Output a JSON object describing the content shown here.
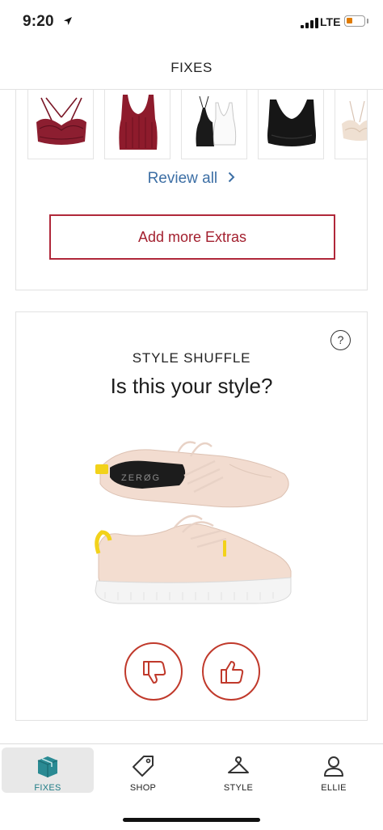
{
  "status_bar": {
    "time": "9:20",
    "network": "LTE",
    "icons": [
      "location-arrow-icon",
      "signal-icon",
      "battery-icon"
    ],
    "battery_color": "#e07b00"
  },
  "nav": {
    "title": "FIXES"
  },
  "extras": {
    "thumbnails": [
      {
        "name": "burgundy lace bralette"
      },
      {
        "name": "burgundy ribbed crop tank"
      },
      {
        "name": "black and white camisoles"
      },
      {
        "name": "black seamless bra"
      },
      {
        "name": "blush lace bralette"
      }
    ],
    "review_label": "Review all",
    "review_icon": "chevron-right-icon",
    "add_button_label": "Add more Extras"
  },
  "style_shuffle": {
    "help_label": "?",
    "eyebrow": "STYLE SHUFFLE",
    "question": "Is this your style?",
    "product_brand_mark": "ZERØG",
    "dislike_icon": "thumbs-down-icon",
    "like_icon": "thumbs-up-icon"
  },
  "tabs": [
    {
      "label": "FIXES",
      "icon": "box-icon",
      "active": true
    },
    {
      "label": "SHOP",
      "icon": "tag-icon",
      "active": false
    },
    {
      "label": "STYLE",
      "icon": "hanger-icon",
      "active": false
    },
    {
      "label": "ELLIE",
      "icon": "person-icon",
      "active": false
    }
  ],
  "colors": {
    "accent_red": "#b0283a",
    "link_blue": "#3d6fa5",
    "active_tab_teal": "#1f7c86"
  }
}
